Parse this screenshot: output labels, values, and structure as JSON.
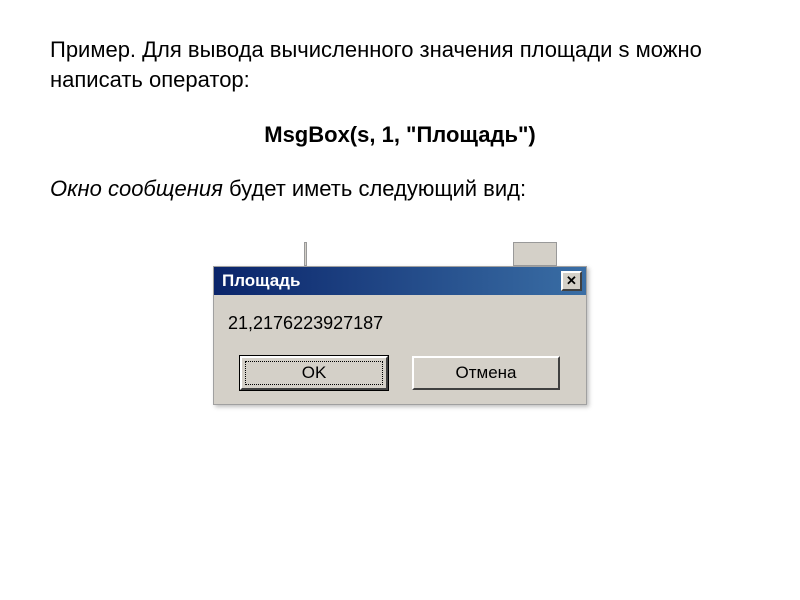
{
  "intro": "Пример. Для вывода вычисленного значения площади s можно написать оператор:",
  "code": "MsgBox(s, 1, \"Площадь\")",
  "follow_prefix_italic": "Окно сообщения",
  "follow_rest": " будет иметь следующий вид:",
  "dialog": {
    "title": "Площадь",
    "close_glyph": "✕",
    "message": "21,2176223927187",
    "ok_label": "OK",
    "cancel_label": "Отмена"
  }
}
